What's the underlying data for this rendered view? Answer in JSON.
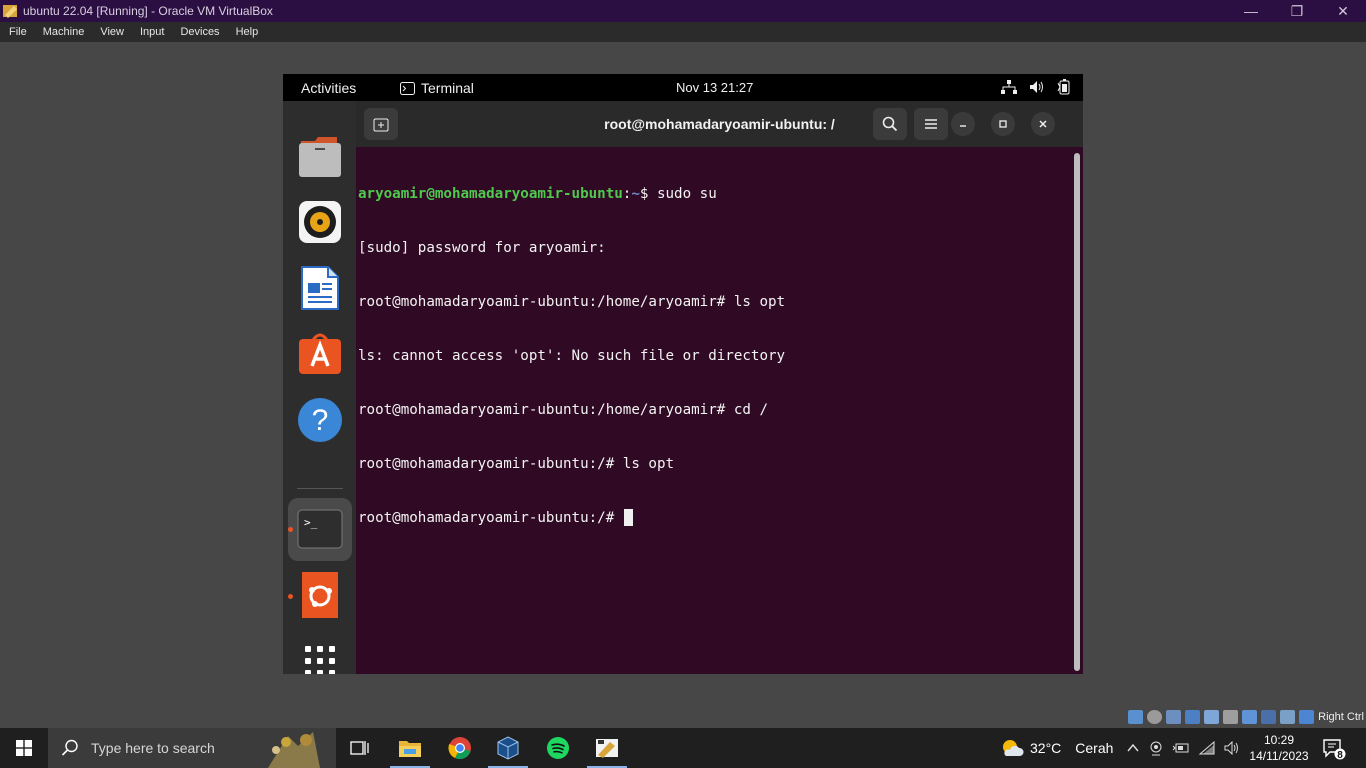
{
  "host_window": {
    "title": "ubuntu 22.04 [Running] - Oracle VM VirtualBox",
    "controls": {
      "minimize": "—",
      "restore": "❐",
      "close": "✕"
    },
    "menu": [
      "File",
      "Machine",
      "View",
      "Input",
      "Devices",
      "Help"
    ]
  },
  "gnome_topbar": {
    "activities": "Activities",
    "app_name": "Terminal",
    "clock": "Nov 13  21:27"
  },
  "dock": {
    "items": [
      "files-icon",
      "rhythmbox-icon",
      "libreoffice-writer-icon",
      "app-center-icon",
      "help-icon",
      "terminal-icon",
      "ubuntu-installer-icon",
      "show-apps-icon"
    ],
    "help_glyph": "?",
    "terminal_glyph": ">_"
  },
  "terminal": {
    "title": "root@mohamadaryoamir-ubuntu: /",
    "lines": {
      "l1_user": "aryoamir@mohamadaryoamir-ubuntu",
      "l1_sep": ":",
      "l1_path": "~",
      "l1_cmd": "$ sudo su",
      "l2": "[sudo] password for aryoamir:",
      "l3": "root@mohamadaryoamir-ubuntu:/home/aryoamir# ls opt",
      "l4": "ls: cannot access 'opt': No such file or directory",
      "l5": "root@mohamadaryoamir-ubuntu:/home/aryoamir# cd /",
      "l6": "root@mohamadaryoamir-ubuntu:/# ls opt",
      "l7": "root@mohamadaryoamir-ubuntu:/# "
    }
  },
  "vb_status": {
    "host_key": "Right Ctrl"
  },
  "taskbar": {
    "search_placeholder": "Type here to search",
    "weather_temp": "32°C",
    "weather_text": "Cerah",
    "time": "10:29",
    "date": "14/11/2023",
    "notification_count": "8",
    "colors": {
      "accent_underline": "#8ab4e8"
    }
  },
  "colors": {
    "terminal_bg": "#300a24",
    "prompt_user": "#4ec94e",
    "prompt_path": "#6d88c7",
    "ubuntu_orange": "#e95420"
  }
}
